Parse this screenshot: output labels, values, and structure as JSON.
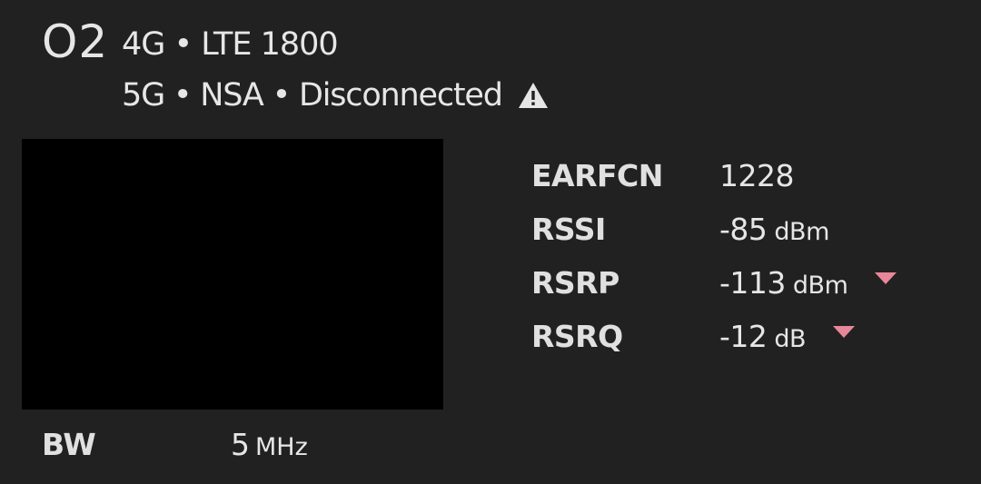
{
  "header": {
    "carrier": "O2",
    "line1": "4G • LTE 1800",
    "line2": "5G • NSA • Disconnected",
    "warning_icon": "warning-triangle-icon"
  },
  "metrics": [
    {
      "label": "EARFCN",
      "value": "1228",
      "unit": "",
      "trend": ""
    },
    {
      "label": "RSSI",
      "value": "-85",
      "unit": "dBm",
      "trend": ""
    },
    {
      "label": "RSRP",
      "value": "-113",
      "unit": "dBm",
      "trend": "down"
    },
    {
      "label": "RSRQ",
      "value": "-12",
      "unit": "dB",
      "trend": "down"
    }
  ],
  "bandwidth": {
    "label": "BW",
    "value": "5",
    "unit": "MHz"
  },
  "colors": {
    "background": "#212121",
    "text": "#e6e6e6",
    "trend_down": "#e8879a",
    "panel": "#000000"
  }
}
